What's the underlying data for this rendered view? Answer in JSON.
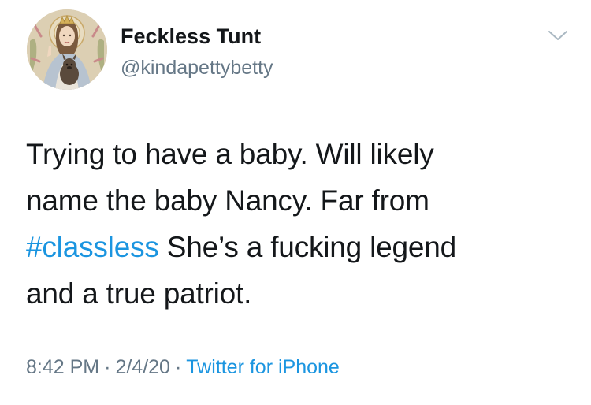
{
  "author": {
    "display_name": "Feckless Tunt",
    "handle": "@kindapettybetty",
    "avatar_icon": "illustrated-portrait-avatar"
  },
  "menu": {
    "icon": "chevron-down-icon"
  },
  "tweet": {
    "line1": "Trying to have a baby. Will likely",
    "line2": "name the baby Nancy. Far from",
    "hashtag": "#classless",
    "line3_rest": " She’s a fucking legend",
    "line4": "and a true patriot."
  },
  "meta": {
    "time": "8:42 PM",
    "separator": "·",
    "date": "2/4/20",
    "source": "Twitter for iPhone"
  },
  "colors": {
    "link": "#1b95e0",
    "secondary_text": "#657786",
    "primary_text": "#14171a"
  }
}
